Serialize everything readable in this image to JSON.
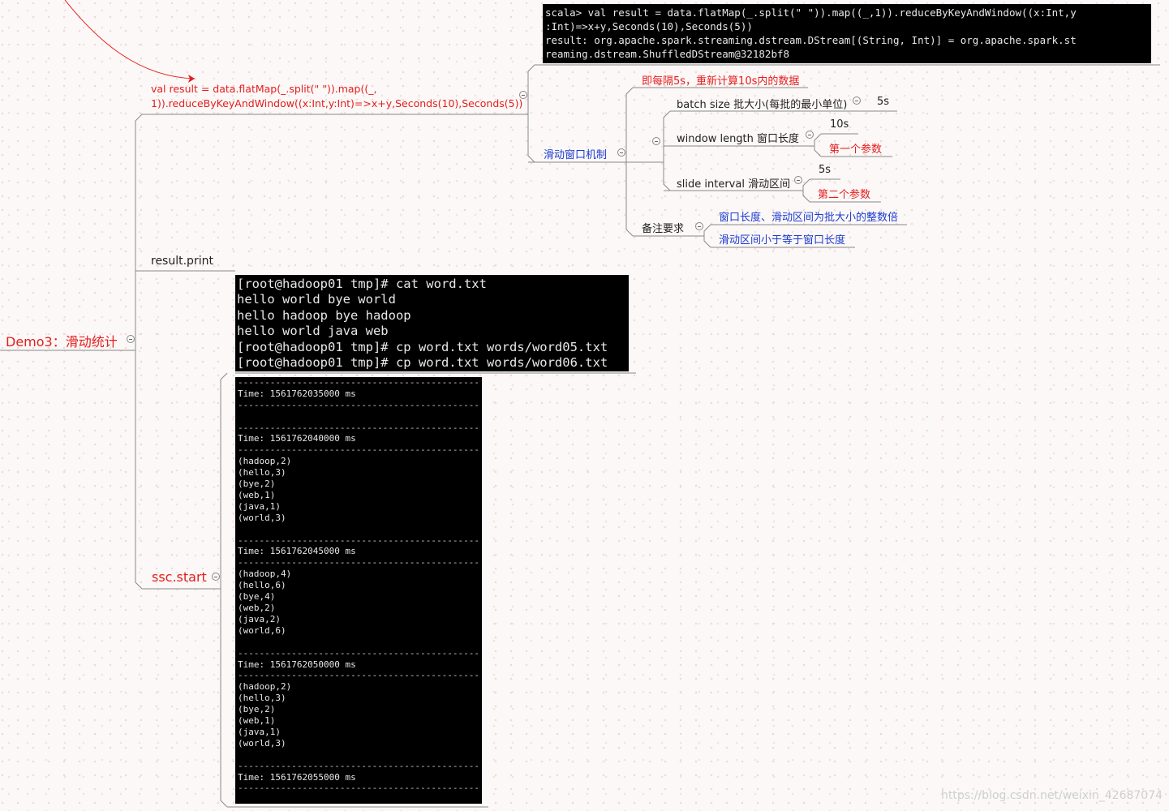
{
  "root": {
    "label": "Demo3：滑动统计"
  },
  "branches": {
    "code": {
      "label_line1": "val result = data.flatMap(_.split(\" \")).map((_,",
      "label_line2": "1)).reduceByKeyAndWindow((x:Int,y:Int)=>x+y,Seconds(10),Seconds(5))"
    },
    "print": {
      "label": "result.print"
    },
    "start": {
      "label": "ssc.start"
    }
  },
  "top_terminal": {
    "lines": [
      "scala> val result = data.flatMap(_.split(\" \")).map((_,1)).reduceByKeyAndWindow((x:Int,y",
      ":Int)=>x+y,Seconds(10),Seconds(5))",
      "result: org.apache.spark.streaming.dstream.DStream[(String, Int)] = org.apache.spark.st",
      "reaming.dstream.ShuffledDStream@32182bf8"
    ]
  },
  "window_mechanism": {
    "label": "滑动窗口机制",
    "note": "即每隔5s，重新计算10s内的数据",
    "batch_size": {
      "label": "batch size 批大小(每批的最小单位)",
      "value": "5s"
    },
    "window_length": {
      "label": "window length 窗口长度",
      "value": "10s",
      "param": "第一个参数"
    },
    "slide_interval": {
      "label": "slide interval 滑动区间",
      "value": "5s",
      "param": "第二个参数"
    },
    "requirements": {
      "label": "备注要求",
      "items": [
        "窗口长度、滑动区间为批大小的整数倍",
        "滑动区间小于等于窗口长度"
      ]
    }
  },
  "cat_terminal": {
    "lines": [
      "[root@hadoop01 tmp]# cat word.txt",
      "hello world bye world",
      "hello hadoop bye hadoop",
      "hello world java web",
      "[root@hadoop01 tmp]# cp word.txt words/word05.txt",
      "[root@hadoop01 tmp]# cp word.txt words/word06.txt"
    ]
  },
  "stream_terminal": {
    "blocks": [
      {
        "time": "Time: 1561762035000 ms",
        "rows": []
      },
      {
        "time": "Time: 1561762040000 ms",
        "rows": [
          "(hadoop,2)",
          "(hello,3)",
          "(bye,2)",
          "(web,1)",
          "(java,1)",
          "(world,3)"
        ]
      },
      {
        "time": "Time: 1561762045000 ms",
        "rows": [
          "(hadoop,4)",
          "(hello,6)",
          "(bye,4)",
          "(web,2)",
          "(java,2)",
          "(world,6)"
        ]
      },
      {
        "time": "Time: 1561762050000 ms",
        "rows": [
          "(hadoop,2)",
          "(hello,3)",
          "(bye,2)",
          "(web,1)",
          "(java,1)",
          "(world,3)"
        ]
      },
      {
        "time": "Time: 1561762055000 ms",
        "rows": []
      }
    ]
  },
  "watermark": "https://blog.csdn.net/weixin_42687074",
  "colors": {
    "red": "#e41d1d",
    "blue": "#1c3bd0",
    "line": "#7a7a7a",
    "terminal_bg": "#000000"
  }
}
